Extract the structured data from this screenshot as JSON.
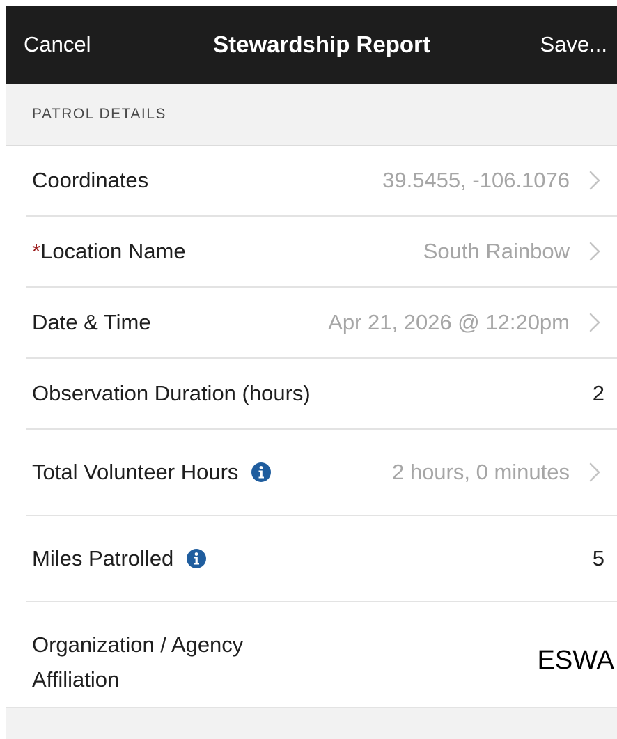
{
  "nav": {
    "cancel_label": "Cancel",
    "title": "Stewardship Report",
    "save_label": "Save..."
  },
  "section": {
    "header": "PATROL DETAILS"
  },
  "rows": {
    "coordinates": {
      "label": "Coordinates",
      "value": "39.5455, -106.1076"
    },
    "location": {
      "required_mark": "*",
      "label": "Location Name",
      "value": "South Rainbow"
    },
    "datetime": {
      "label": "Date & Time",
      "value": "Apr 21, 2026 @ 12:20pm"
    },
    "observation": {
      "label": "Observation Duration (hours)",
      "value": "2"
    },
    "volunteer": {
      "label": "Total Volunteer Hours",
      "value": "2 hours, 0 minutes",
      "icon": "info-icon"
    },
    "miles": {
      "label": "Miles Patrolled",
      "value": "5",
      "icon": "info-icon"
    },
    "organization": {
      "label_line1": "Organization / Agency",
      "label_line2": "Affiliation",
      "value": "ESWA"
    }
  },
  "colors": {
    "navbar_bg": "#1d1d1d",
    "required_red": "#9b1b1b",
    "info_blue": "#1f5d9e",
    "muted_value": "#a6a6a6",
    "background_gray": "#f2f2f2"
  }
}
